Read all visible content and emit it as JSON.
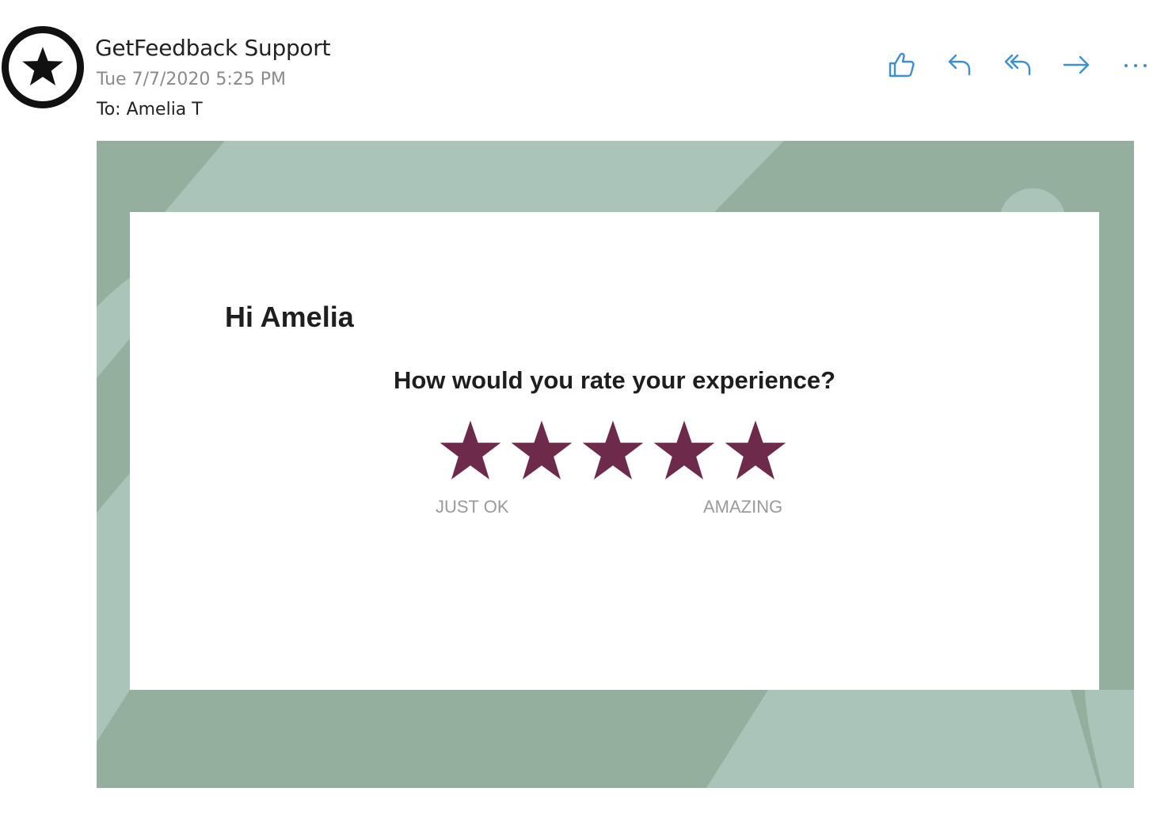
{
  "email": {
    "sender": "GetFeedback Support",
    "timestamp": "Tue 7/7/2020 5:25 PM",
    "recipient": "To: Amelia T",
    "avatar_icon": "star-icon"
  },
  "actions": [
    {
      "icon": "thumbs-up-icon",
      "name": "like"
    },
    {
      "icon": "reply-icon",
      "name": "reply"
    },
    {
      "icon": "reply-all-icon",
      "name": "reply-all"
    },
    {
      "icon": "forward-icon",
      "name": "forward"
    },
    {
      "icon": "more-icon",
      "name": "more"
    }
  ],
  "survey": {
    "greeting": "Hi Amelia",
    "question": "How would you rate your experience?",
    "rating_scale": 5,
    "label_low": "JUST OK",
    "label_high": "AMAZING"
  },
  "colors": {
    "action_blue": "#3e8fd0",
    "star_color": "#6e2a4b",
    "background_green": "#95af9f",
    "background_light_green": "#aac4b9"
  }
}
